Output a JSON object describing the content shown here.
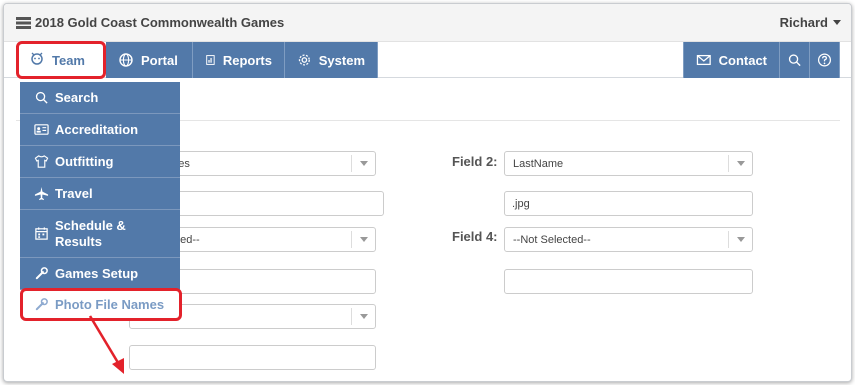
{
  "app": {
    "title": "2018 Gold Coast Commonwealth Games",
    "user": "Richard"
  },
  "nav": {
    "team": "Team",
    "portal": "Portal",
    "reports": "Reports",
    "system": "System",
    "contact": "Contact"
  },
  "team_menu": {
    "items": [
      {
        "label": "Search",
        "icon": "search-icon"
      },
      {
        "label": "Accreditation",
        "icon": "id-card-icon"
      },
      {
        "label": "Outfitting",
        "icon": "shirt-icon"
      },
      {
        "label": "Travel",
        "icon": "plane-icon"
      },
      {
        "label": "Schedule & Results",
        "icon": "calendar-icon"
      },
      {
        "label": "Games Setup",
        "icon": "wrench-icon"
      },
      {
        "label": "Photo File Names",
        "icon": "wrench-icon"
      }
    ]
  },
  "form": {
    "field1_select_partial": "ames",
    "field2_label": "Field 2:",
    "field2_value": "LastName",
    "field2_ext": ".jpg",
    "field3_select_partial": "lected--",
    "field4_label": "Field 4:",
    "field4_value": "--Not Selected--",
    "field5_select_partial": "elected--"
  },
  "colors": {
    "accent": "#5279a9",
    "highlight": "#e3222b"
  }
}
